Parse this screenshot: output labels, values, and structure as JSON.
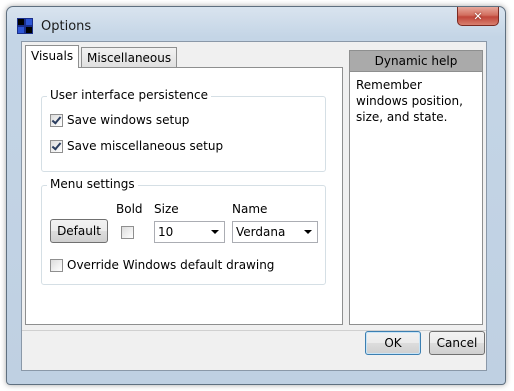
{
  "window": {
    "title": "Options",
    "close_glyph": "✕"
  },
  "tabs": [
    {
      "label": "Visuals",
      "active": true
    },
    {
      "label": "Miscellaneous",
      "active": false
    }
  ],
  "persistence_group": {
    "title": "User interface persistence",
    "save_windows": {
      "label": "Save windows setup",
      "checked": true
    },
    "save_misc": {
      "label": "Save miscellaneous setup",
      "checked": true
    }
  },
  "menu_group": {
    "title": "Menu settings",
    "bold_label": "Bold",
    "bold_checked": false,
    "size_label": "Size",
    "size_value": "10",
    "name_label": "Name",
    "name_value": "Verdana",
    "default_button": "Default",
    "override": {
      "label": "Override Windows default drawing",
      "checked": false
    }
  },
  "help": {
    "header": "Dynamic help",
    "text": "Remember windows position, size, and state."
  },
  "buttons": {
    "ok": "OK",
    "cancel": "Cancel"
  },
  "colors": {
    "titlebar": "#c4d5e6",
    "close_button": "#c0463a",
    "help_header": "#aaaaaa"
  }
}
